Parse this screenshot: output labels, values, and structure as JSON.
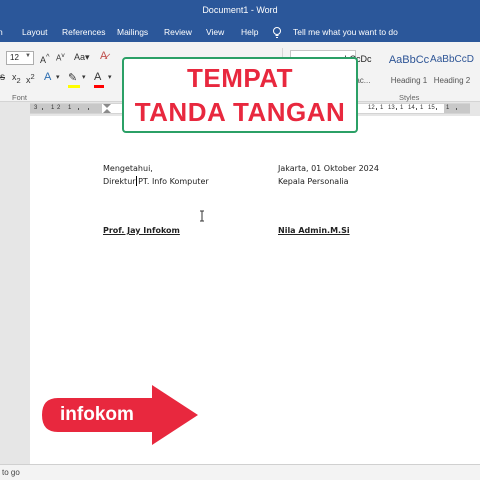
{
  "window": {
    "title": "Document1 - Word"
  },
  "menu": {
    "tabs": [
      "n",
      "Layout",
      "References",
      "Mailings",
      "Review",
      "View",
      "Help"
    ],
    "tell_me": "Tell me what you want to do"
  },
  "ribbon": {
    "font_size": "12",
    "font_group_label": "Font",
    "styles_group_label": "Styles",
    "styles": [
      {
        "preview": "hCcDc",
        "name": "Spac..."
      },
      {
        "preview": "AaBbCc",
        "name": "Heading 1"
      },
      {
        "preview": "AaBbCcD",
        "name": "Heading 2"
      }
    ],
    "highlight_color": "#ffff00",
    "font_color": "#ff0000"
  },
  "ruler": {
    "labels": [
      "3",
      "1",
      "2",
      "1",
      "12",
      "1",
      "13",
      "1",
      "14",
      "1",
      "15",
      "1"
    ]
  },
  "overlay": {
    "banner_line1": "TEMPAT",
    "banner_line2": "TANDA TANGAN",
    "badge": "infokom"
  },
  "document": {
    "left": {
      "line1": "Mengetahui,",
      "line2": "Direktur PT. Info Komputer",
      "signer": "Prof. Jay Infokom"
    },
    "right": {
      "line1": "Jakarta, 01 Oktober 2024",
      "line2": "Kepala Personalia",
      "signer": "Nila Admin.M.Si"
    }
  },
  "status": {
    "text": "to go"
  },
  "colors": {
    "accent": "#2b579a",
    "banner_text": "#e8283e",
    "banner_border": "#2ba066",
    "arrow": "#e8283e"
  }
}
